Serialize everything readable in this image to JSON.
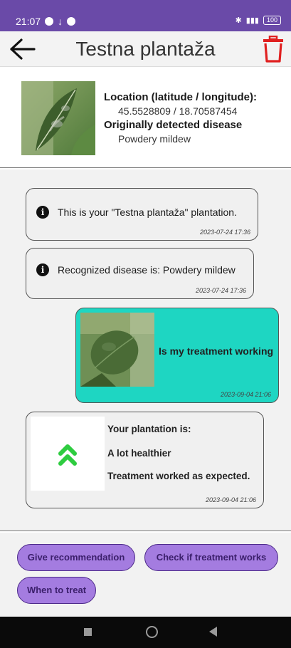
{
  "status_bar": {
    "time": "21:07",
    "battery": "100",
    "icons": [
      "notification-icon",
      "download-icon",
      "notification-icon",
      "bluetooth-icon",
      "signal-icon",
      "battery-icon"
    ]
  },
  "app_bar": {
    "title": "Testna plantaža",
    "back_icon": "arrow-left-icon",
    "delete_icon": "trash-icon",
    "delete_color": "#e02020"
  },
  "header": {
    "location_label": "Location (latitude / longitude):",
    "location_value": "45.5528809 / 18.70587454",
    "disease_label": "Originally detected disease",
    "disease_value": "Powdery mildew"
  },
  "messages": [
    {
      "text": "This is your \"Testna plantaža\" plantation.",
      "time": "2023-07-24 17:36",
      "icon": "info-icon"
    },
    {
      "text": "Recognized disease is: Powdery mildew",
      "time": "2023-07-24 17:36",
      "icon": "info-icon"
    },
    {
      "text": "Is my treatment working",
      "time": "2023-09-04 21:06",
      "image": "leaf-photo",
      "background": "#1ed6c2"
    },
    {
      "line1": "Your plantation is:",
      "line2": "A lot healthier",
      "line3": "Treatment worked as expected.",
      "time": "2023-09-04 21:06",
      "icon": "double-chevron-up-icon",
      "icon_color": "#2ecc40"
    }
  ],
  "actions": {
    "give_recommendation": "Give recommendation",
    "check_treatment": "Check if treatment works",
    "when_to_treat": "When to treat"
  },
  "colors": {
    "status_bar": "#6a4aa8",
    "button": "#a47ce0",
    "user_bubble": "#1ed6c2"
  }
}
